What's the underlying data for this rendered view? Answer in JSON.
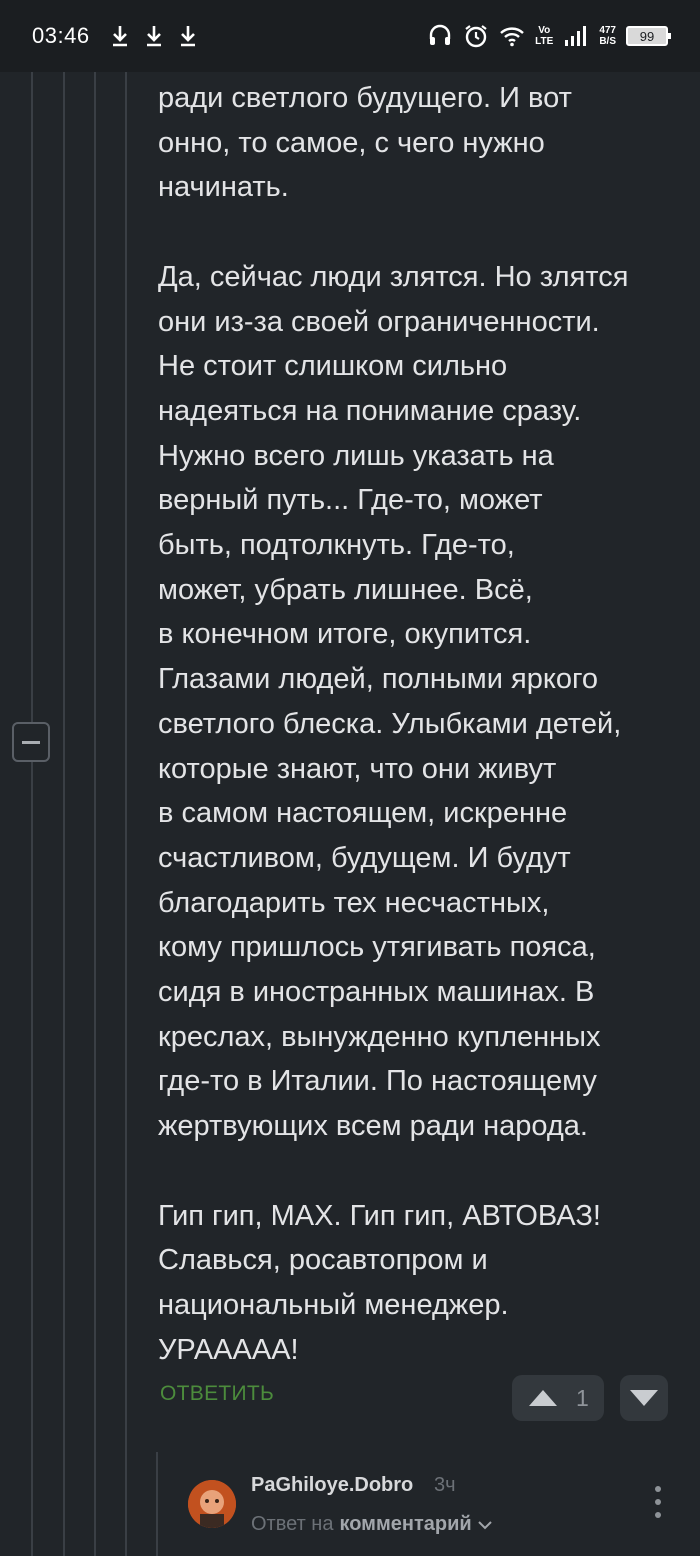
{
  "status_bar": {
    "time": "03:46",
    "icons": [
      "download-icon",
      "download-icon",
      "download-icon",
      "headset-icon",
      "alarm-icon",
      "wifi-icon",
      "volte-icon",
      "signal-icon"
    ],
    "volte_top": "Vo",
    "volte_bottom": "LTE",
    "net_speed_value": "477",
    "net_speed_unit": "B/S",
    "battery": "99"
  },
  "comment": {
    "paragraphs": [
      [
        "ради светлого будущего. И вот",
        "онно, то самое, с чего нужно",
        "начинать."
      ],
      [
        "Да, сейчас люди злятся. Но злятся",
        "они из-за своей ограниченности.",
        "Не стоит слишком сильно",
        "надеяться на понимание сразу.",
        "Нужно всего лишь указать на",
        "верный путь... Где-то, может",
        "быть, подтолкнуть. Где-то,",
        "может, убрать лишнее. Всё,",
        "в конечном итоге, окупится.",
        "Глазами людей, полными яркого",
        "светлого блеска. Улыбками детей,",
        "которые знают, что они живут",
        "в самом настоящем, искренне",
        "счастливом, будущем. И будут",
        "благодарить тех несчастных,",
        "кому пришлось утягивать пояса,",
        "сидя в иностранных машинах. В",
        "креслах, вынужденно купленных",
        "где-то в Италии. По настоящему",
        "жертвующих всем ради народа."
      ],
      [
        "Гип гип, MAX. Гип гип, АВТОВАЗ!",
        "Славься, росавтопром и",
        "национальный менеджер.",
        "УРААААА!"
      ]
    ],
    "reply_label": "ОТВЕТИТЬ",
    "vote_count": "1"
  },
  "child_comment": {
    "author": "PaGhiloye.Dobro",
    "time": "3ч",
    "reply_prefix": "Ответ на",
    "reply_target": "комментарий"
  },
  "colors": {
    "background": "#212529",
    "reply_green": "#4c8c3c",
    "text": "#e3e4e6"
  }
}
